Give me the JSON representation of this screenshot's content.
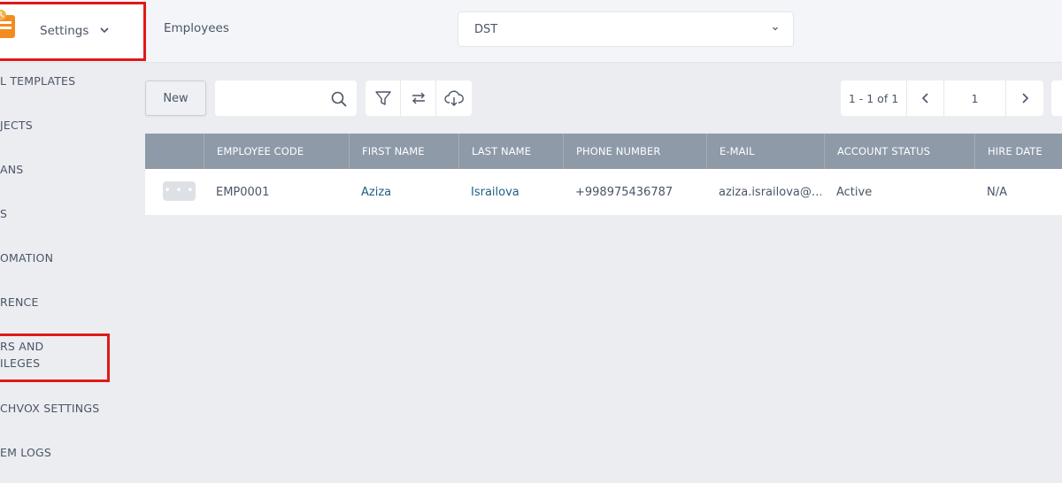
{
  "header": {
    "app_switcher_label": "Settings",
    "page_title": "Employees",
    "company_select_value": "DST"
  },
  "sidebar": {
    "items": [
      {
        "label": "L TEMPLATES"
      },
      {
        "label": "JECTS"
      },
      {
        "label": "ANS"
      },
      {
        "label": "S"
      },
      {
        "label": "OMATION"
      },
      {
        "label": "RENCE"
      },
      {
        "label": "RS AND\nILEGES"
      },
      {
        "label": "CHVOX SETTINGS"
      },
      {
        "label": "EM LOGS"
      }
    ]
  },
  "toolbar": {
    "new_label": "New",
    "search_value": "",
    "search_placeholder": ""
  },
  "pager": {
    "info": "1 - 1 of 1",
    "page": "1"
  },
  "table": {
    "columns": [
      "EMPLOYEE CODE",
      "FIRST NAME",
      "LAST NAME",
      "PHONE NUMBER",
      "E-MAIL",
      "ACCOUNT STATUS",
      "HIRE DATE"
    ],
    "rows": [
      {
        "menu": "• • •",
        "employee_code": "EMP0001",
        "first_name": "Aziza",
        "last_name": "Israilova",
        "phone": "+998975436787",
        "email": "aziza.israilova@…",
        "status": "Active",
        "hire_date": "N/A"
      }
    ]
  },
  "colors": {
    "accent_orange": "#f28c1e",
    "highlight_red": "#e01919",
    "table_header": "#8e9aa8",
    "link": "#1f5f85"
  }
}
